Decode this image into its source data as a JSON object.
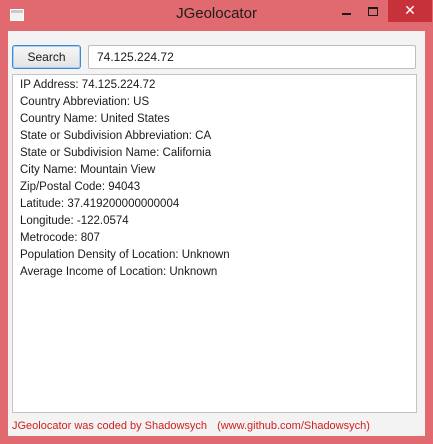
{
  "window": {
    "title": "JGeolocator",
    "accent_color": "#e06a6f",
    "close_color": "#c7323a"
  },
  "toolbar": {
    "search_label": "Search",
    "ip_value": "74.125.224.72"
  },
  "results": [
    "IP Address: 74.125.224.72",
    "Country Abbreviation: US",
    "Country Name: United States",
    "State or Subdivision Abbreviation: CA",
    "State or Subdivision Name: California",
    "City Name: Mountain View",
    "Zip/Postal Code: 94043",
    "Latitude: 37.419200000000004",
    "Longitude: -122.0574",
    "Metrocode: 807",
    "Population Density of Location: Unknown",
    "Average Income of Location: Unknown"
  ],
  "footer": {
    "credit": "JGeolocator was coded by Shadowsych",
    "link": "(www.github.com/Shadowsych)",
    "color": "#d21f1f"
  },
  "icons": {
    "app": "window-app-icon",
    "minimize": "minimize-icon",
    "maximize": "maximize-icon",
    "close": "close-icon"
  }
}
